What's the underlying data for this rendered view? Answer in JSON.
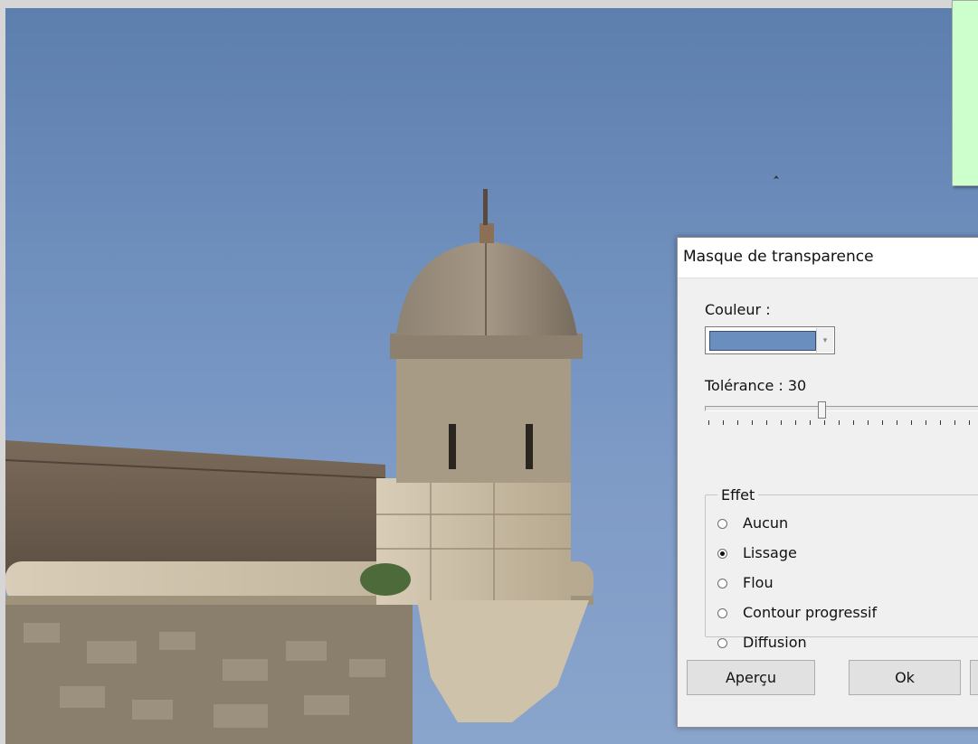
{
  "dialog": {
    "title": "Masque de transparence",
    "color_label": "Couleur :",
    "color_value": "#6a8fbf",
    "tolerance_label": "Tolérance : 30",
    "tolerance_value": 30,
    "effect_group_label": "Effet",
    "effects": [
      {
        "label": "Aucun",
        "checked": false
      },
      {
        "label": "Lissage",
        "checked": true
      },
      {
        "label": "Flou",
        "checked": false
      },
      {
        "label": "Contour progressif",
        "checked": false
      },
      {
        "label": "Diffusion",
        "checked": false
      }
    ],
    "buttons": {
      "preview_label": "Aperçu",
      "ok_label": "Ok"
    }
  },
  "colors": {
    "note_background": "#ccffcc",
    "dialog_background": "#f0f0f0",
    "sky": "#6f8fbd"
  }
}
